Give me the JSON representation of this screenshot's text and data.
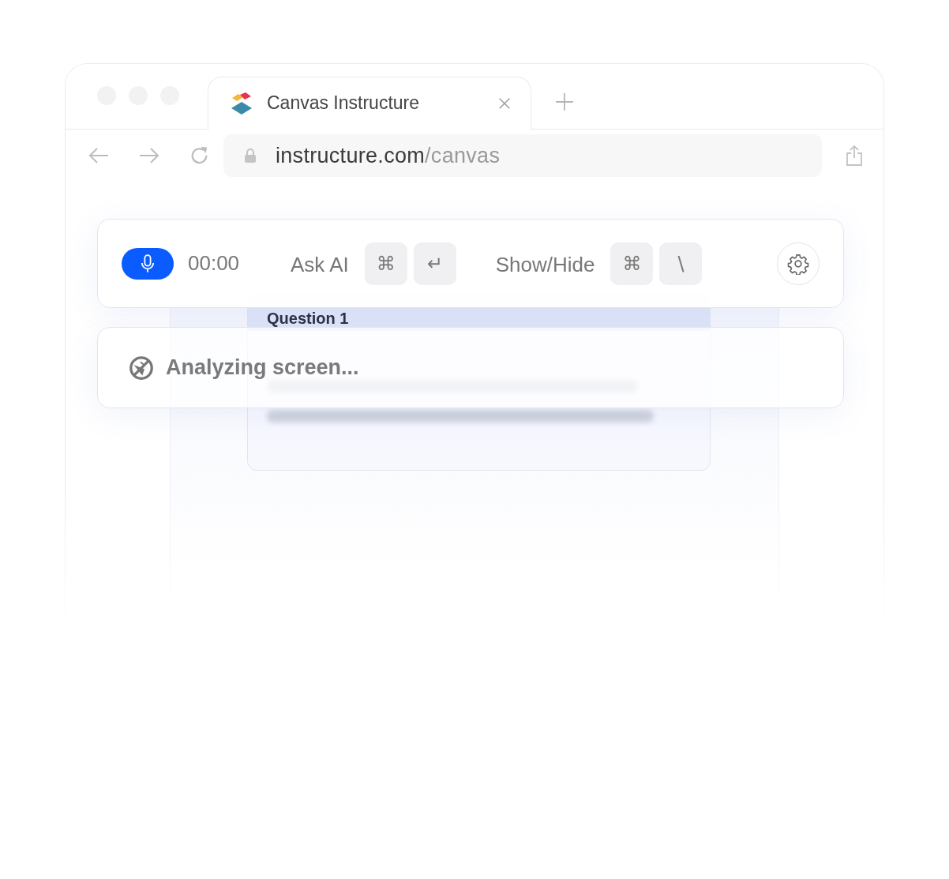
{
  "tabs": [
    {
      "title": "Canvas Instructure",
      "selected": true
    }
  ],
  "address": {
    "domain": "instructure.com",
    "path": "/canvas"
  },
  "toolbar": {
    "timer": "00:00",
    "shortcuts": [
      {
        "label": "Ask AI",
        "keys": [
          "⌘",
          "↵"
        ]
      },
      {
        "label": "Show/Hide",
        "keys": [
          "⌘",
          "\\"
        ]
      }
    ]
  },
  "question": {
    "title": "Question 1"
  },
  "status": {
    "text": "Analyzing screen..."
  }
}
